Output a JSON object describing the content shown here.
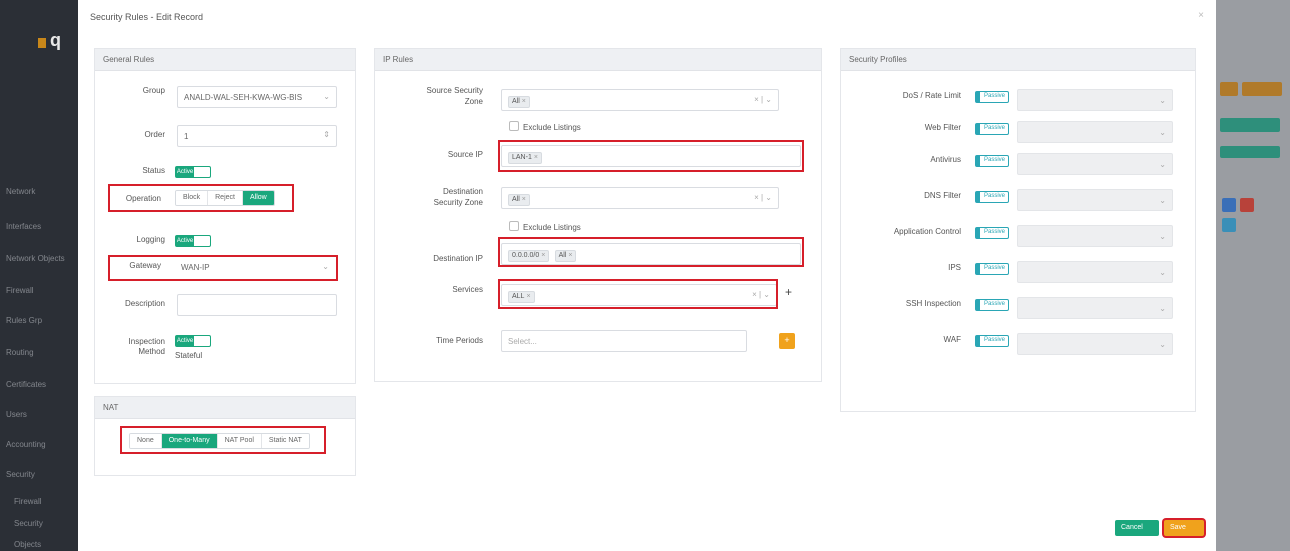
{
  "modal": {
    "title": "Security Rules - Edit Record",
    "close": "×"
  },
  "general_rules": {
    "title": "General Rules",
    "group_label": "Group",
    "group_value": "ANALD-WAL-SEH-KWA-WG-BIS",
    "order_label": "Order",
    "order_value": "1",
    "status_label": "Status",
    "status_on": "Active",
    "operation_label": "Operation",
    "operation_options": [
      "Block",
      "Reject",
      "Allow"
    ],
    "operation_selected": "Allow",
    "logging_label": "Logging",
    "logging_on": "Active",
    "gateway_label": "Gateway",
    "gateway_value": "WAN-IP",
    "description_label": "Description",
    "description_value": "",
    "inspection_label_1": "Inspection",
    "inspection_label_2": "Method",
    "inspection_on": "Active",
    "inspection_sub": "Stateful"
  },
  "nat": {
    "title": "NAT",
    "options": [
      "None",
      "One-to-Many",
      "NAT Pool",
      "Static NAT"
    ],
    "selected": "One-to-Many"
  },
  "ip_rules": {
    "title": "IP Rules",
    "src_zone_label_1": "Source Security",
    "src_zone_label_2": "Zone",
    "src_zone_tag": "All",
    "exclude_listings_src": "Exclude Listings",
    "source_ip_label": "Source IP",
    "source_ip_tag": "LAN-1",
    "dst_zone_label_1": "Destination",
    "dst_zone_label_2": "Security Zone",
    "dst_zone_tag": "All",
    "exclude_listings_dst": "Exclude Listings",
    "dst_ip_label": "Destination IP",
    "dst_ip_tags": [
      "0.0.0.0/0",
      "All"
    ],
    "services_label": "Services",
    "services_tag": "ALL",
    "add_symbol": "+",
    "time_periods_label": "Time Periods",
    "time_periods_placeholder": "Select...",
    "time_periods_btn": "+"
  },
  "security_profiles": {
    "title": "Security Profiles",
    "off_label": "Passive",
    "rows": [
      "DoS / Rate Limit",
      "Web Filter",
      "Antivirus",
      "DNS Filter",
      "Application Control",
      "IPS",
      "SSH Inspection",
      "WAF"
    ]
  },
  "footer": {
    "cancel": "Cancel",
    "save": "Save"
  },
  "background": {
    "logo_letter": "q",
    "nav_items": [
      "Network",
      "Interfaces",
      "Network Objects",
      "Firewall",
      "Rules Grp",
      "Routing",
      "Certificates",
      "Users",
      "Accounting",
      "Security",
      "Firewall",
      "Security",
      "Objects"
    ]
  },
  "colors": {
    "accent_green": "#1aa77d",
    "highlight_red": "#d61f2a",
    "save_orange": "#f0a21c",
    "teal": "#2aa6b5"
  }
}
